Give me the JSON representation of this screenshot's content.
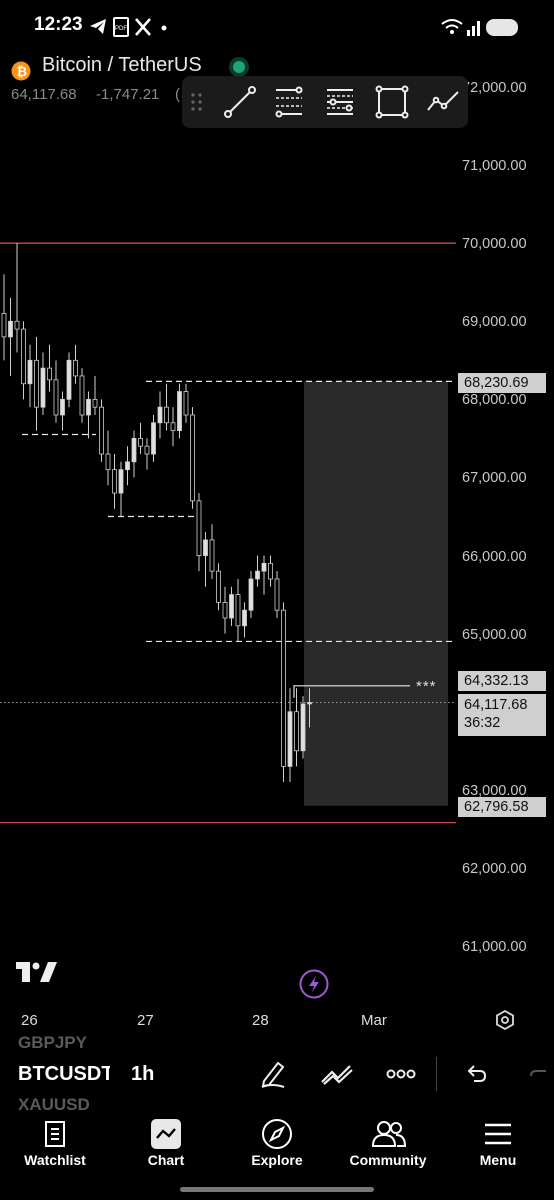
{
  "status": {
    "time": "12:23"
  },
  "header": {
    "title": "Bitcoin / TetherUS",
    "last_price": "64,117.68",
    "change": "-1,747.21",
    "change_suffix": "("
  },
  "axis": {
    "price_labels": [
      "72,000.00",
      "71,000.00",
      "70,000.00",
      "69,000.00",
      "68,000.00",
      "67,000.00",
      "66,000.00",
      "65,000.00",
      "63,000.00",
      "62,000.00",
      "61,000.00"
    ],
    "date_labels": [
      "26",
      "27",
      "28",
      "Mar"
    ]
  },
  "tags": {
    "level_high": "68,230.69",
    "level_mid": "64,332.13",
    "current_price": "64,117.68",
    "countdown": "36:32",
    "level_low": "62,796.58"
  },
  "annotation": {
    "stars": "***"
  },
  "symbar": {
    "prev_symbol": "GBPJPY",
    "symbol": "BTCUSDT",
    "interval": "1h",
    "next_symbol": "XAUUSD"
  },
  "nav": {
    "watchlist": "Watchlist",
    "chart": "Chart",
    "explore": "Explore",
    "community": "Community",
    "menu": "Menu"
  },
  "colors": {
    "accent_green": "#1fa37a",
    "bitcoin_orange": "#f7931a",
    "red_line": "#d04a55",
    "flash_purple": "#9c5bd6"
  },
  "chart_data": {
    "type": "candlestick",
    "title": "Bitcoin / TetherUS",
    "interval": "1h",
    "ylim": [
      60800,
      72100
    ],
    "x_ticks": [
      "26",
      "27",
      "28",
      "Mar"
    ],
    "horizontal_lines": [
      70000,
      62580
    ],
    "dashed_levels": [
      68230.69,
      67550,
      66500,
      64900
    ],
    "box": {
      "top": 68230.69,
      "bottom": 62796.58
    },
    "candles": [
      [
        69100,
        69600,
        68500,
        68800
      ],
      [
        68800,
        69300,
        68300,
        69000
      ],
      [
        69000,
        70000,
        68600,
        68900
      ],
      [
        68900,
        69000,
        68000,
        68200
      ],
      [
        68200,
        68700,
        67900,
        68500
      ],
      [
        68500,
        68800,
        67600,
        67900
      ],
      [
        67900,
        68600,
        67800,
        68400
      ],
      [
        68400,
        68700,
        68100,
        68250
      ],
      [
        68250,
        68500,
        67700,
        67800
      ],
      [
        67800,
        68100,
        67600,
        68000
      ],
      [
        68000,
        68600,
        67900,
        68500
      ],
      [
        68500,
        68700,
        68200,
        68300
      ],
      [
        68300,
        68400,
        67700,
        67800
      ],
      [
        67800,
        68100,
        67500,
        68000
      ],
      [
        68000,
        68300,
        67800,
        67900
      ],
      [
        67900,
        68000,
        67200,
        67300
      ],
      [
        67300,
        67600,
        66900,
        67100
      ],
      [
        67100,
        67300,
        66600,
        66800
      ],
      [
        66800,
        67200,
        66500,
        67100
      ],
      [
        67100,
        67400,
        66900,
        67200
      ],
      [
        67200,
        67600,
        67000,
        67500
      ],
      [
        67500,
        67700,
        67300,
        67400
      ],
      [
        67400,
        67500,
        67100,
        67300
      ],
      [
        67300,
        67800,
        67200,
        67700
      ],
      [
        67700,
        68100,
        67500,
        67900
      ],
      [
        67900,
        68200,
        67600,
        67700
      ],
      [
        67700,
        67900,
        67400,
        67600
      ],
      [
        67600,
        68200,
        67500,
        68100
      ],
      [
        68100,
        68200,
        67700,
        67800
      ],
      [
        67800,
        67900,
        66600,
        66700
      ],
      [
        66700,
        66800,
        65800,
        66000
      ],
      [
        66000,
        66300,
        65600,
        66200
      ],
      [
        66200,
        66400,
        65700,
        65800
      ],
      [
        65800,
        65900,
        65300,
        65400
      ],
      [
        65400,
        65600,
        65000,
        65200
      ],
      [
        65200,
        65600,
        65100,
        65500
      ],
      [
        65500,
        65700,
        64900,
        65100
      ],
      [
        65100,
        65400,
        64950,
        65300
      ],
      [
        65300,
        65800,
        65200,
        65700
      ],
      [
        65700,
        66000,
        65600,
        65800
      ],
      [
        65800,
        66000,
        65500,
        65900
      ],
      [
        65900,
        66000,
        65600,
        65700
      ],
      [
        65700,
        65800,
        65200,
        65300
      ],
      [
        65300,
        65400,
        63100,
        63300
      ],
      [
        63300,
        64300,
        63100,
        64000
      ],
      [
        64000,
        64300,
        63300,
        63500
      ],
      [
        63500,
        64200,
        63400,
        64100
      ],
      [
        64100,
        64300,
        63800,
        64117.68
      ]
    ]
  }
}
